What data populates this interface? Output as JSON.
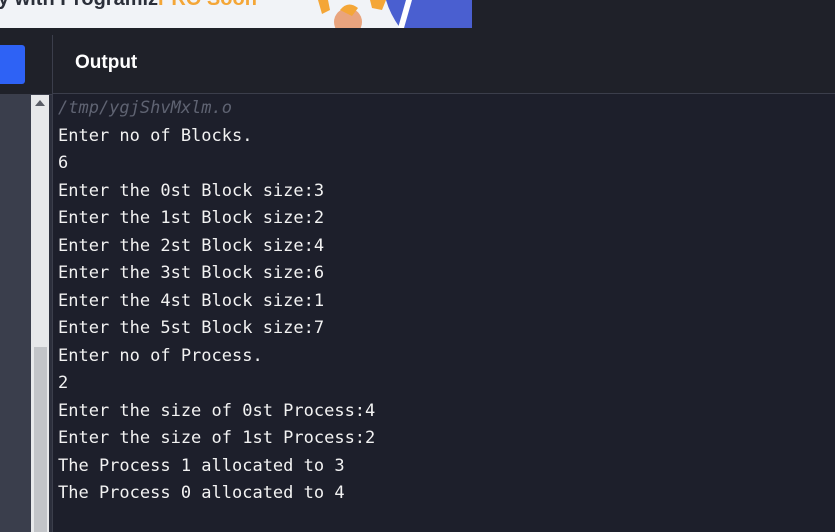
{
  "banner": {
    "text_start": "y with Programiz",
    "text_accent": "PRO Soon"
  },
  "output": {
    "title": "Output",
    "path": "/tmp/ygjShvMxlm.o",
    "lines": [
      "Enter no of Blocks.",
      "6",
      "Enter the 0st Block size:3",
      "Enter the 1st Block size:2",
      "Enter the 2st Block size:4",
      "Enter the 3st Block size:6",
      "Enter the 4st Block size:1",
      "Enter the 5st Block size:7",
      "Enter no of Process.",
      "2",
      "Enter the size of 0st Process:4",
      "Enter the size of 1st Process:2",
      "The Process 1 allocated to 3",
      "The Process 0 allocated to 4"
    ]
  },
  "colors": {
    "background": "#1d1f2b",
    "header": "#1f2129",
    "run_button": "#2e62f5",
    "text": "#f2f2f2",
    "path_text": "#5f6372"
  },
  "icons": {
    "scroll_up": "scroll-up-arrow-icon"
  }
}
